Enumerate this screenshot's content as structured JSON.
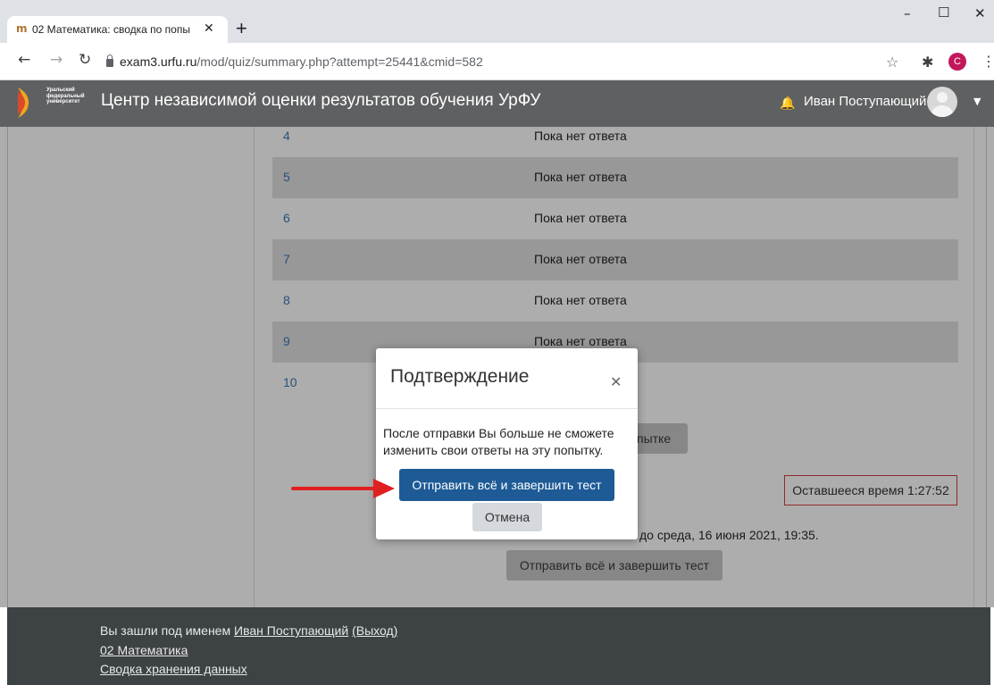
{
  "browser": {
    "tab_title": "02 Математика: сводка по попы",
    "tab_favicon": "m",
    "url_host": "exam3.urfu.ru",
    "url_path": "/mod/quiz/summary.php?attempt=25441&cmid=582",
    "profile_initial": "C",
    "icons": [
      "back-icon",
      "forward-icon",
      "reload-icon",
      "lock-icon",
      "star-icon",
      "extensions-icon",
      "menu-icon"
    ]
  },
  "navbar": {
    "logo_text": "Уральский федеральный университет",
    "site_name": "Центр независимой оценки результатов обучения УрФУ",
    "user_name": "Иван Поступающий"
  },
  "questions": [
    {
      "number": "4",
      "status": "Пока нет ответа"
    },
    {
      "number": "5",
      "status": "Пока нет ответа"
    },
    {
      "number": "6",
      "status": "Пока нет ответа"
    },
    {
      "number": "7",
      "status": "Пока нет ответа"
    },
    {
      "number": "8",
      "status": "Пока нет ответа"
    },
    {
      "number": "9",
      "status": "Пока нет ответа"
    },
    {
      "number": "10",
      "status": ""
    }
  ],
  "page": {
    "return_button_partial": "пытке",
    "timer": "Оставшееся время 1:27:52",
    "deadline": "до среда, 16 июня 2021, 19:35.",
    "submit_button": "Отправить всё и завершить тест"
  },
  "modal": {
    "title": "Подтверждение",
    "body": "После отправки Вы больше не сможете изменить свои ответы на эту попытку.",
    "confirm_button": "Отправить всё и завершить тест",
    "cancel_button": "Отмена"
  },
  "footer": {
    "logged_in_prefix": "Вы зашли под именем ",
    "user_link": "Иван Поступающий",
    "logout_link": "(Выход)",
    "course_link": "02 Математика",
    "data_summary_link": "Сводка хранения данных"
  },
  "colors": {
    "primary": "#1d5a96",
    "navbar": "#5f6062",
    "footer": "#3d4245",
    "link": "#3b78b6",
    "timer_border": "#d43f3f",
    "arrow": "#e02020"
  }
}
